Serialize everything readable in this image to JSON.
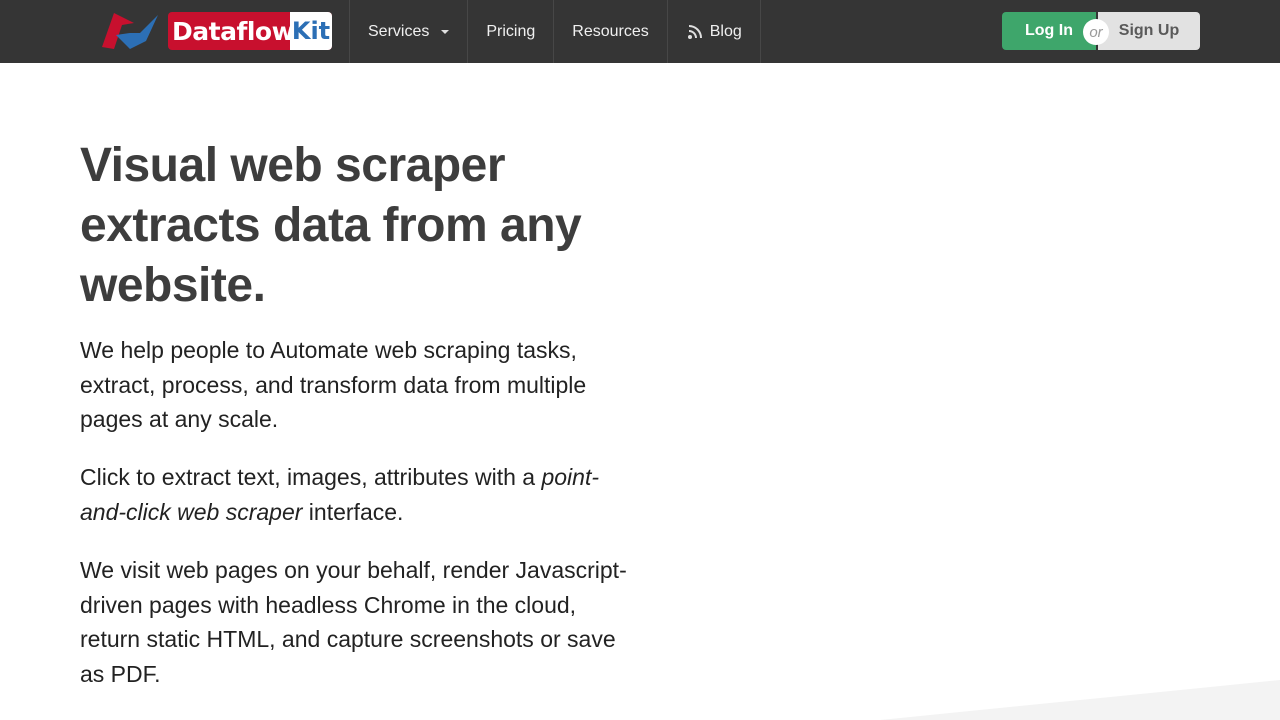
{
  "header": {
    "logo": {
      "word": "Dataflow",
      "kit": "Kit",
      "brand_red": "#c8102e",
      "brand_blue": "#2c6fb5"
    },
    "nav": [
      {
        "label": "Services",
        "has_dropdown": true
      },
      {
        "label": "Pricing"
      },
      {
        "label": "Resources"
      },
      {
        "label": "Blog",
        "icon": "rss-icon"
      }
    ],
    "auth": {
      "login_label": "Log In",
      "or_label": "or",
      "signup_label": "Sign Up",
      "login_color": "#3ea66b"
    }
  },
  "hero": {
    "title": "Visual web scraper extracts data from any website.",
    "p1": "We help people to Automate web scraping tasks, extract, process, and transform data from multiple pages at any scale.",
    "p2_before": "Click to extract text, images, attributes with a ",
    "p2_emphasis": "point-and-click web scraper",
    "p2_after": " interface.",
    "p3": "We visit web pages on your behalf, render Javascript-driven pages with headless Chrome in the cloud, return static HTML, and capture screenshots or save as PDF."
  }
}
